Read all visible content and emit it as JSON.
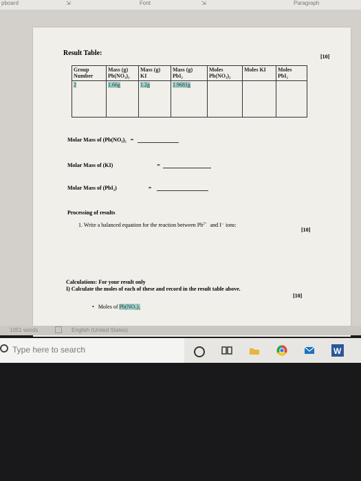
{
  "ribbon": {
    "clipboard": "pboard",
    "font": "Font",
    "paragraph": "Paragraph"
  },
  "doc": {
    "result_table_title": "Result Table:",
    "marks_1": "[10]",
    "table_headers": [
      [
        "Group",
        "Number"
      ],
      [
        "Mass (g)",
        "Pb(NO₃)₂"
      ],
      [
        "Mass (g)",
        "KI"
      ],
      [
        "Mass (g)",
        "PbI₂"
      ],
      [
        "Moles",
        "Pb(NO₃)₂"
      ],
      [
        "Moles KI",
        ""
      ],
      [
        "Moles",
        "PbI₂"
      ]
    ],
    "table_row": [
      "2",
      "1.66g",
      "1.2g",
      "1.9681g",
      "",
      "",
      ""
    ],
    "molar_pbno3": "Molar Mass of (Pb(NO₃)₂",
    "molar_ki": "Molar Mass of (KI)",
    "molar_pbi2": "Molar Mass of (PbI₂)",
    "equals": "=",
    "processing_title": "Processing of results",
    "q1_prefix": "1. Write a balanced equation for the reaction between Pb",
    "q1_sup": "2+",
    "q1_suffix": "and I⁻ ions:",
    "marks_2": "[10]",
    "calc_title": "Calculations: For your result only",
    "calc_item": "I) Calculate the moles of each of these and record in the result table above.",
    "marks_3": "[10]",
    "bullet_moles_prefix": "Moles of ",
    "bullet_moles_formula": "Pb(NO₃)₂"
  },
  "status": {
    "words": "1051 words",
    "language": "English (United States)"
  },
  "taskbar": {
    "search_placeholder": "Type here to search"
  },
  "colors": {
    "highlight": "#9fd0c9",
    "page": "#f1efea"
  }
}
